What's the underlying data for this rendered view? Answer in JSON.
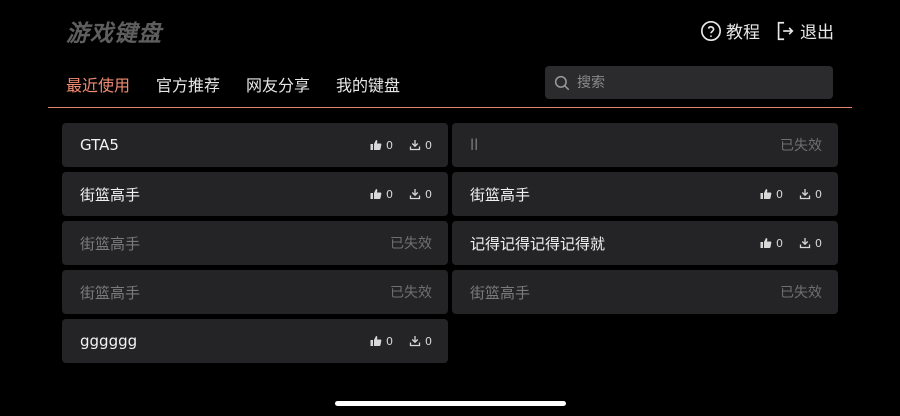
{
  "header": {
    "title": "游戏键盘",
    "tutorial_label": "教程",
    "logout_label": "退出"
  },
  "tabs": [
    {
      "label": "最近使用",
      "active": true
    },
    {
      "label": "官方推荐",
      "active": false
    },
    {
      "label": "网友分享",
      "active": false
    },
    {
      "label": "我的键盘",
      "active": false
    }
  ],
  "search": {
    "placeholder": "搜索",
    "value": ""
  },
  "colors": {
    "accent": "#f08a72",
    "card_bg": "#242426",
    "background": "#000000"
  },
  "keyboards_left": [
    {
      "name": "GTA5",
      "likes": "0",
      "downloads": "0",
      "status": ""
    },
    {
      "name": "街篮高手",
      "likes": "0",
      "downloads": "0",
      "status": ""
    },
    {
      "name": "街篮高手",
      "likes": "",
      "downloads": "",
      "status": "已失效"
    },
    {
      "name": "街篮高手",
      "likes": "",
      "downloads": "",
      "status": "已失效"
    },
    {
      "name": "gggggg",
      "likes": "0",
      "downloads": "0",
      "status": ""
    }
  ],
  "keyboards_right": [
    {
      "name": "ll",
      "likes": "",
      "downloads": "",
      "status": "已失效"
    },
    {
      "name": "街篮高手",
      "likes": "0",
      "downloads": "0",
      "status": ""
    },
    {
      "name": "记得记得记得记得就",
      "likes": "0",
      "downloads": "0",
      "status": ""
    },
    {
      "name": "街篮高手",
      "likes": "",
      "downloads": "",
      "status": "已失效"
    }
  ]
}
